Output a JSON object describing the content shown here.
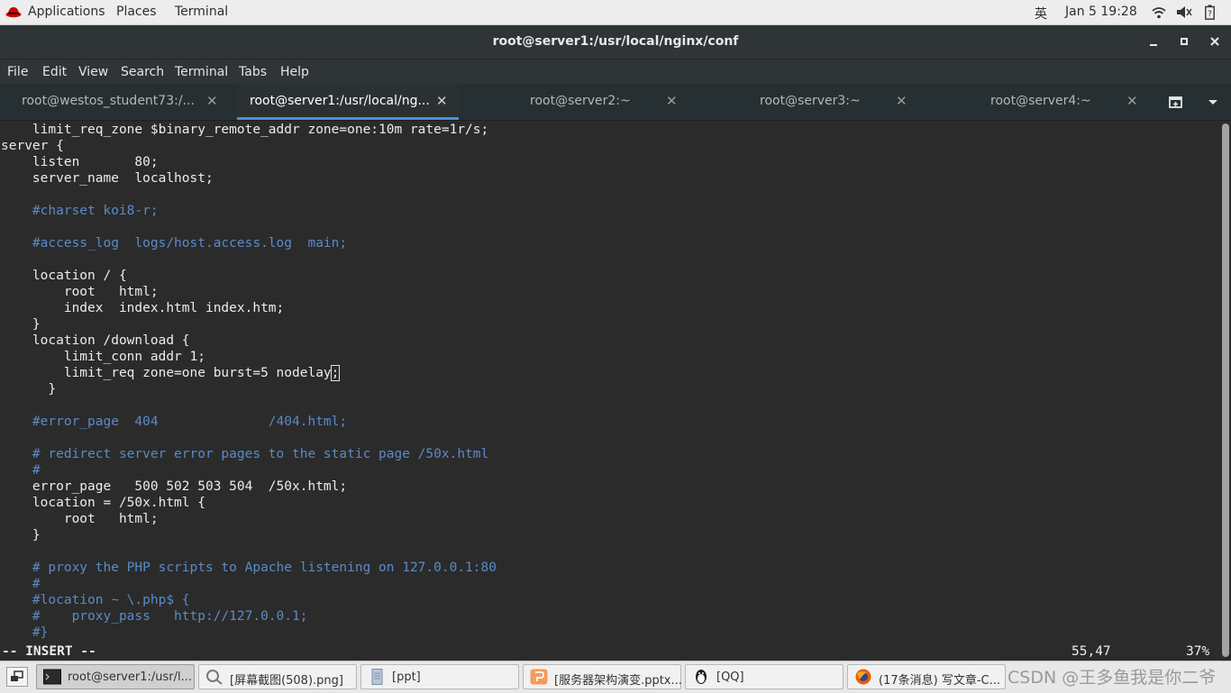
{
  "topbar": {
    "applications": "Applications",
    "places": "Places",
    "terminal": "Terminal",
    "ime": "英",
    "clock": "Jan 5  19:28",
    "icons": [
      "wifi-icon",
      "volume-icon",
      "battery-icon"
    ]
  },
  "window": {
    "title": "root@server1:/usr/local/nginx/conf"
  },
  "menubar": [
    "File",
    "Edit",
    "View",
    "Search",
    "Terminal",
    "Tabs",
    "Help"
  ],
  "tabs": [
    {
      "label": "root@westos_student73:/..."
    },
    {
      "label": "root@server1:/usr/local/ng..."
    },
    {
      "label": "root@server2:~"
    },
    {
      "label": "root@server3:~"
    },
    {
      "label": "root@server4:~"
    }
  ],
  "terminal_lines": [
    {
      "text": "    limit_req_zone $binary_remote_addr zone=one:10m rate=1r/s;",
      "comment": false
    },
    {
      "text": "server {",
      "comment": false
    },
    {
      "text": "    listen       80;",
      "comment": false
    },
    {
      "text": "    server_name  localhost;",
      "comment": false
    },
    {
      "text": "",
      "comment": false
    },
    {
      "text": "    #charset koi8-r;",
      "comment": true
    },
    {
      "text": "",
      "comment": false
    },
    {
      "text": "    #access_log  logs/host.access.log  main;",
      "comment": true
    },
    {
      "text": "",
      "comment": false
    },
    {
      "text": "    location / {",
      "comment": false
    },
    {
      "text": "        root   html;",
      "comment": false
    },
    {
      "text": "        index  index.html index.htm;",
      "comment": false
    },
    {
      "text": "    }",
      "comment": false
    },
    {
      "text": "    location /download {",
      "comment": false
    },
    {
      "text": "        limit_conn addr 1;",
      "comment": false
    },
    {
      "text": "        limit_req zone=one burst=5 nodelay",
      "comment": false,
      "cursor": ";"
    },
    {
      "text": "      }",
      "comment": false
    },
    {
      "text": "",
      "comment": false
    },
    {
      "text": "    #error_page  404              /404.html;",
      "comment": true
    },
    {
      "text": "",
      "comment": false
    },
    {
      "text": "    # redirect server error pages to the static page /50x.html",
      "comment": true
    },
    {
      "text": "    #",
      "comment": true
    },
    {
      "text": "    error_page   500 502 503 504  /50x.html;",
      "comment": false
    },
    {
      "text": "    location = /50x.html {",
      "comment": false
    },
    {
      "text": "        root   html;",
      "comment": false
    },
    {
      "text": "    }",
      "comment": false
    },
    {
      "text": "",
      "comment": false
    },
    {
      "text": "    # proxy the PHP scripts to Apache listening on 127.0.0.1:80",
      "comment": true
    },
    {
      "text": "    #",
      "comment": true
    },
    {
      "text": "    #location ~ \\.php$ {",
      "comment": true
    },
    {
      "text": "    #    proxy_pass   http://127.0.0.1;",
      "comment": true
    },
    {
      "text": "    #}",
      "comment": true
    }
  ],
  "statusline": {
    "mode": "-- INSERT --",
    "position": "55,47",
    "percent": "37%"
  },
  "taskbar": {
    "items": [
      {
        "label": "root@server1:/usr/l..."
      },
      {
        "label": "[屏幕截图(508).png]"
      },
      {
        "label": "[ppt]"
      },
      {
        "label": "[服务器架构演变.pptx..."
      },
      {
        "label": "[QQ]"
      },
      {
        "label": "(17条消息) 写文章-C..."
      }
    ],
    "watermark": "CSDN @王多鱼我是你二爷"
  },
  "colors": {
    "terminal_bg": "#2b2b2b",
    "comment": "#5b8ac7",
    "tab_accent": "#4a90d9"
  }
}
